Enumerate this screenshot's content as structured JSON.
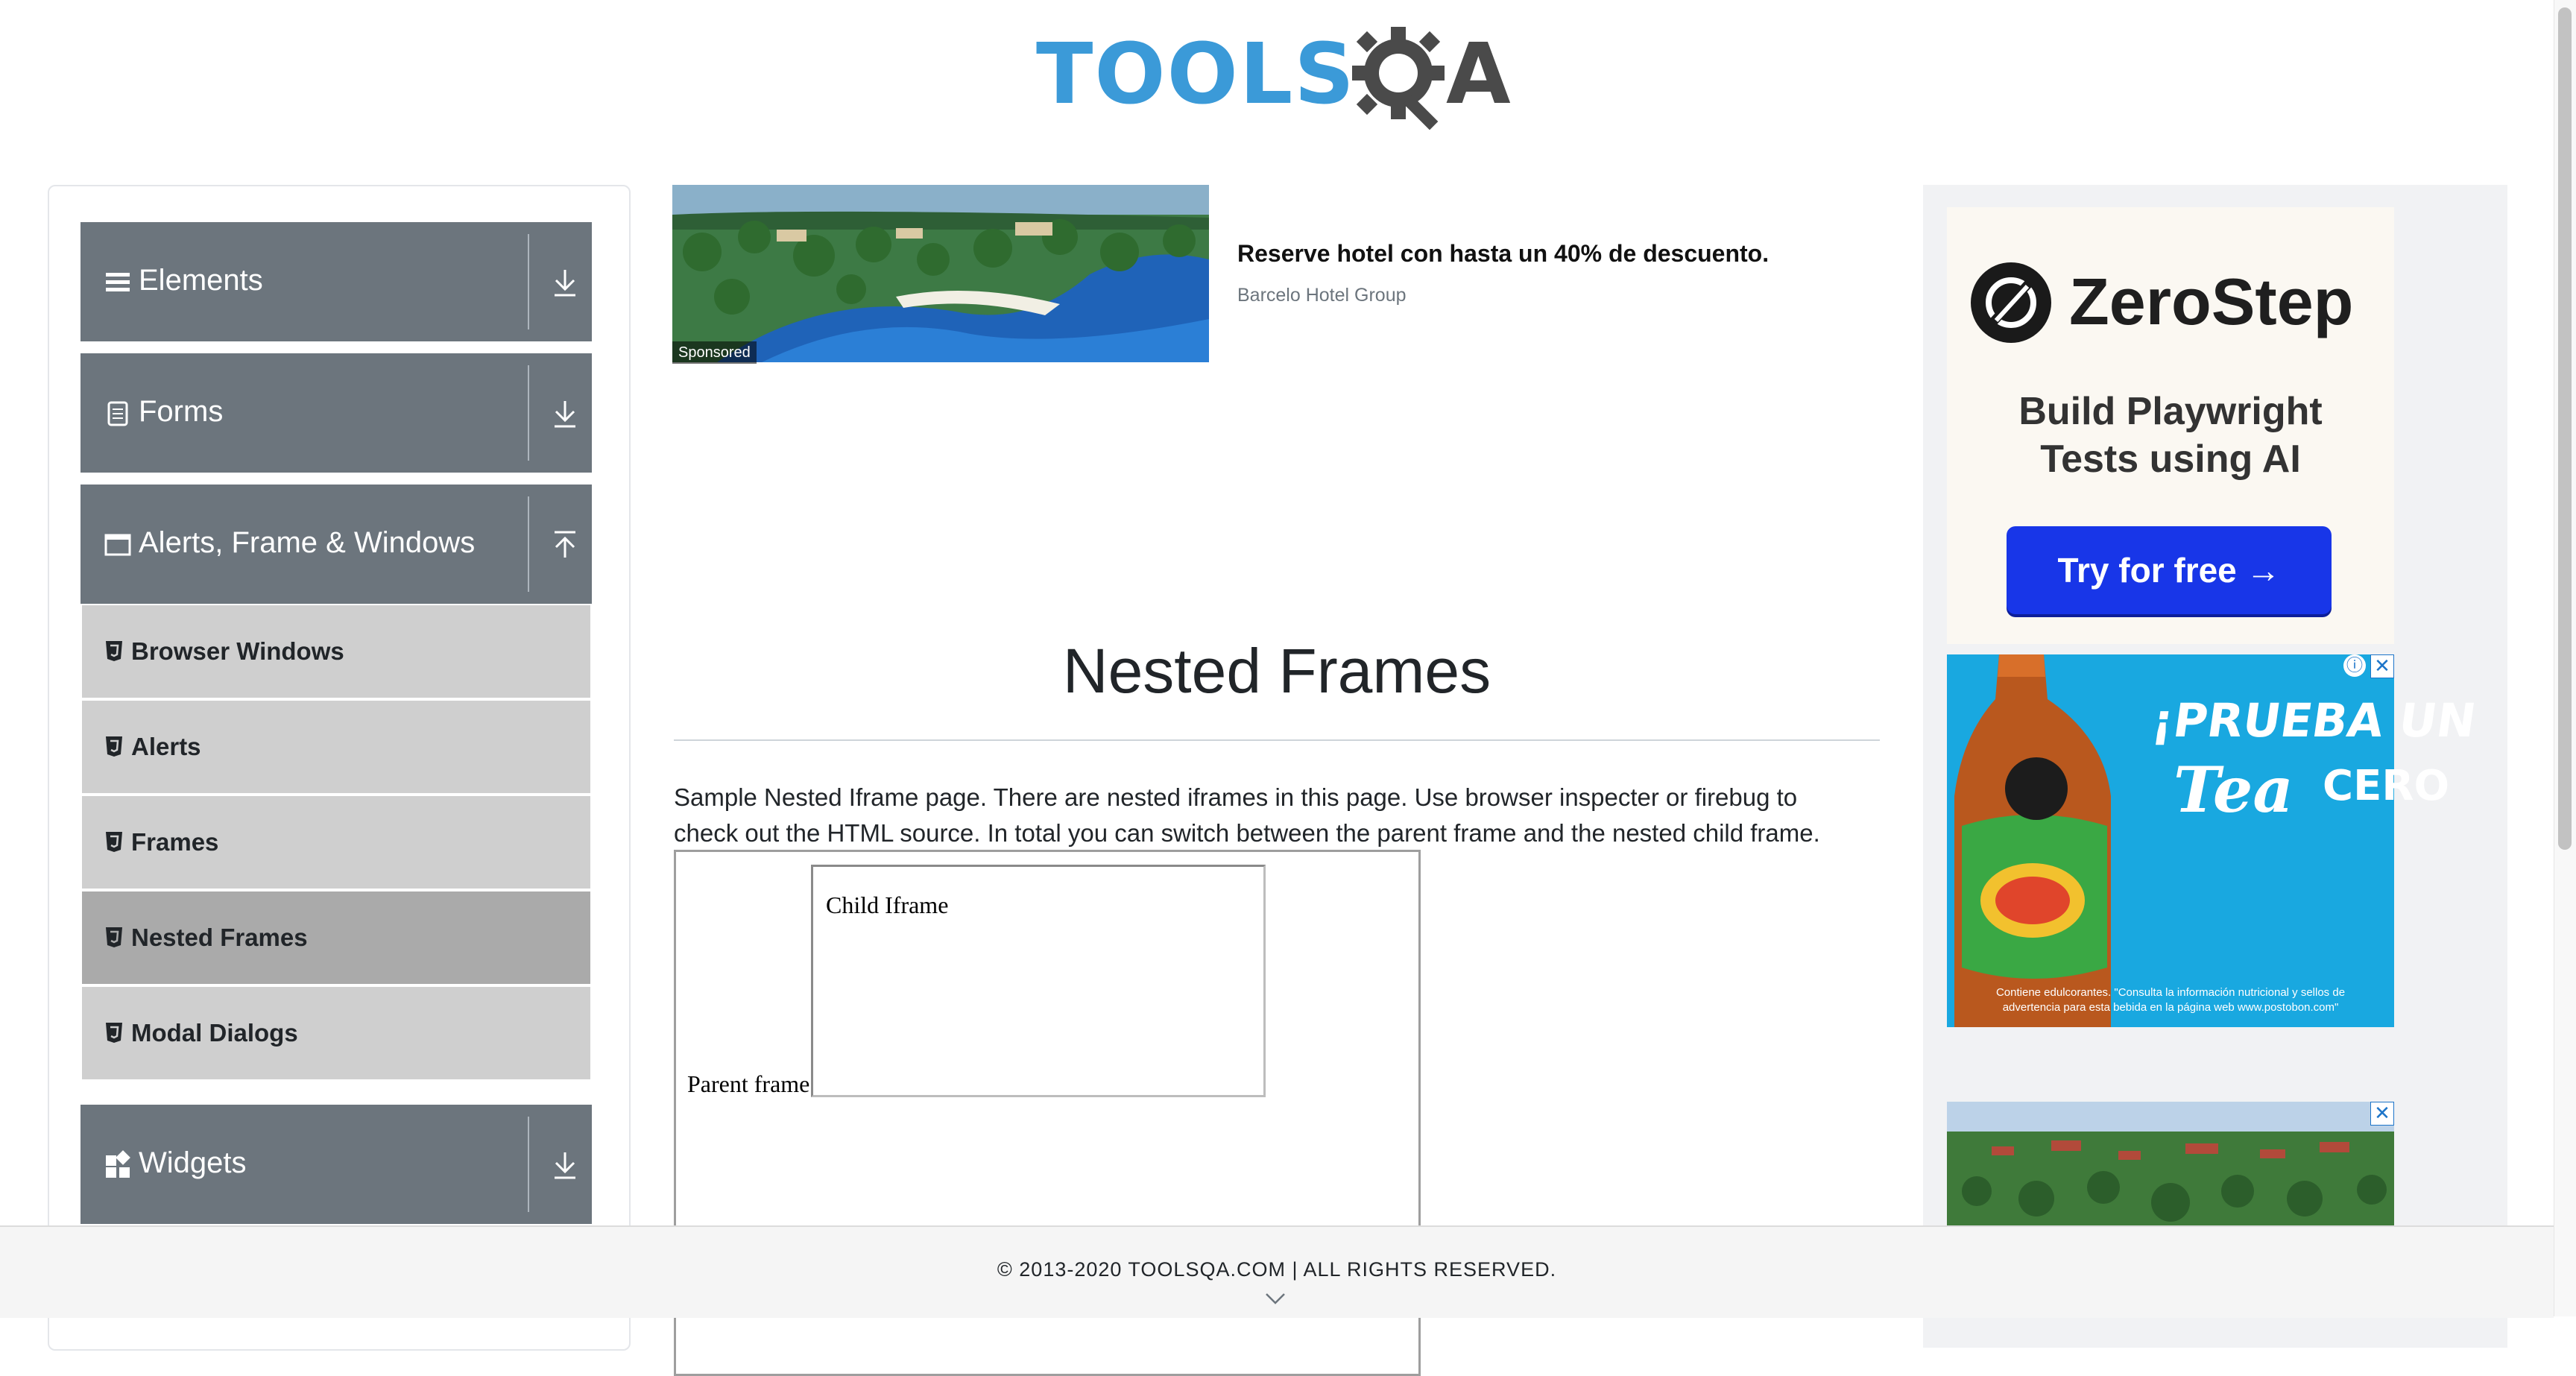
{
  "header": {
    "logo_left": "TOOLS",
    "logo_right": "A"
  },
  "sidebar": {
    "groups": [
      {
        "label": "Elements",
        "icon": "list-icon",
        "expanded": false
      },
      {
        "label": "Forms",
        "icon": "document-icon",
        "expanded": false
      },
      {
        "label": "Alerts, Frame & Windows",
        "icon": "window-icon",
        "expanded": true
      },
      {
        "label": "Widgets",
        "icon": "widgets-icon",
        "expanded": false
      }
    ],
    "items": [
      {
        "label": "Browser Windows",
        "active": false
      },
      {
        "label": "Alerts",
        "active": false
      },
      {
        "label": "Frames",
        "active": false
      },
      {
        "label": "Nested Frames",
        "active": true
      },
      {
        "label": "Modal Dialogs",
        "active": false
      }
    ]
  },
  "sponsored_ad": {
    "badge": "Sponsored",
    "title": "Reserve hotel con hasta un 40% de descuento.",
    "advertiser": "Barcelo Hotel Group"
  },
  "main": {
    "title": "Nested Frames",
    "description": "Sample Nested Iframe page. There are nested iframes in this page. Use browser inspecter or firebug to check out the HTML source. In total you can switch between the parent frame and the nested child frame.",
    "parent_frame_label": "Parent frame",
    "child_frame_label": "Child Iframe"
  },
  "right_ads": {
    "zerostep": {
      "brand": "ZeroStep",
      "tagline_line1": "Build Playwright",
      "tagline_line2": "Tests using AI",
      "cta": "Try for free →"
    },
    "tea": {
      "headline": "¡PRUEBA UN",
      "brand": "Tea",
      "suffix": "CERO",
      "fine_print_1": "Contiene edulcorantes. \"Consulta la información nutricional y sellos de",
      "fine_print_2": "advertencia para esta bebida en la página web www.postobon.com\""
    },
    "close_symbol": "✕",
    "info_symbol": "ⓘ"
  },
  "footer": {
    "text": "© 2013-2020 TOOLSQA.COM | ALL RIGHTS RESERVED."
  },
  "colors": {
    "sidebar_group": "#6c757d",
    "sidebar_item": "#cfcfcf",
    "sidebar_item_active": "#aaaaaa",
    "logo_blue": "#3b9ad8",
    "logo_dark": "#4a4a4a",
    "cta_blue": "#1836e8"
  }
}
